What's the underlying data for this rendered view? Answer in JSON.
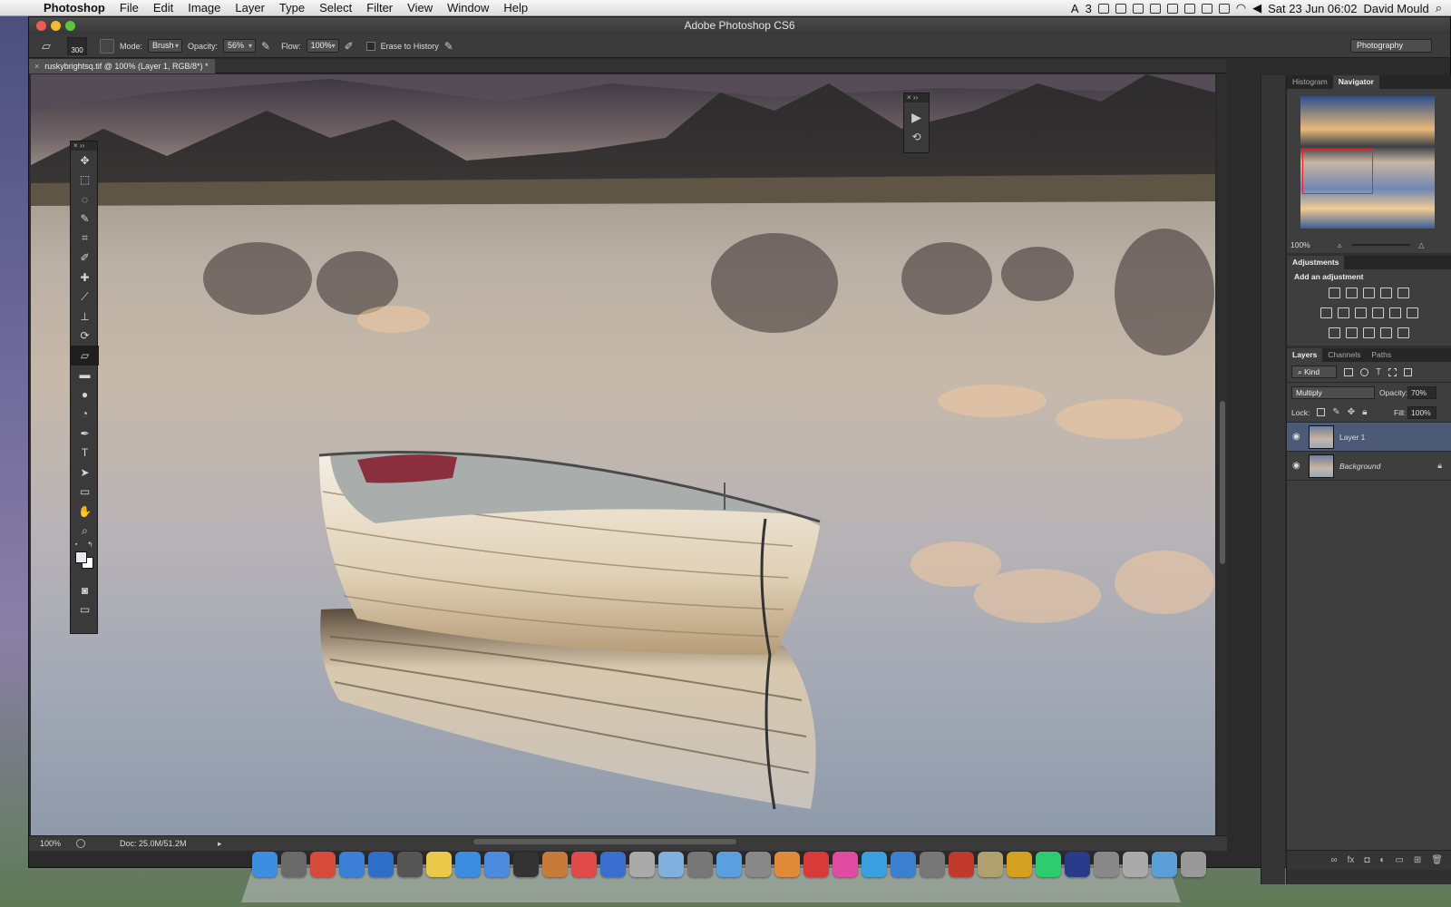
{
  "menubar": {
    "app": "Photoshop",
    "items": [
      "File",
      "Edit",
      "Image",
      "Layer",
      "Type",
      "Select",
      "Filter",
      "View",
      "Window",
      "Help"
    ],
    "status_badge": "3",
    "clock": "Sat 23 Jun  06:02",
    "user": "David Mould"
  },
  "window": {
    "title": "Adobe Photoshop CS6"
  },
  "options": {
    "brush_size": "300",
    "mode_label": "Mode:",
    "mode": "Brush",
    "opacity_label": "Opacity:",
    "opacity": "56%",
    "flow_label": "Flow:",
    "flow": "100%",
    "erase_history": "Erase to History",
    "workspace": "Photography"
  },
  "document": {
    "tab": "ruskybrightsq.tif @ 100% (Layer 1, RGB/8*) *",
    "zoom": "100%",
    "doc_size": "Doc: 25.0M/51.2M"
  },
  "tools": [
    "move-tool",
    "marquee-tool",
    "lasso-tool",
    "quick-selection-tool",
    "crop-tool",
    "eyedropper-tool",
    "healing-tool",
    "brush-tool",
    "clone-stamp-tool",
    "history-brush-tool",
    "eraser-tool",
    "gradient-tool",
    "blur-tool",
    "dodge-tool",
    "pen-tool",
    "type-tool",
    "path-selection-tool",
    "shape-tool",
    "hand-tool",
    "zoom-tool"
  ],
  "tool_glyphs": [
    "✥",
    "⬚",
    "◌",
    "✎",
    "⌗",
    "✐",
    "✚",
    "⟋",
    "⊥",
    "⟳",
    "▱",
    "▬",
    "●",
    "◔",
    "✒",
    "T",
    "➤",
    "▭",
    "✋",
    "⌕"
  ],
  "navigator": {
    "tabs": [
      "Histogram",
      "Navigator"
    ],
    "zoom": "100%",
    "active_tab": "Navigator"
  },
  "adjustments": {
    "title": "Adjustments",
    "subtitle": "Add an adjustment"
  },
  "layers": {
    "tabs": [
      "Layers",
      "Channels",
      "Paths"
    ],
    "filter": "Kind",
    "blend_mode": "Multiply",
    "opacity_label": "Opacity:",
    "opacity": "70%",
    "lock_label": "Lock:",
    "fill_label": "Fill:",
    "fill": "100%",
    "items": [
      {
        "name": "Layer 1",
        "selected": true
      },
      {
        "name": "Background",
        "locked": true
      }
    ]
  },
  "colors": {
    "selection": "#4c5a78",
    "accent": "#3d7bd9"
  }
}
